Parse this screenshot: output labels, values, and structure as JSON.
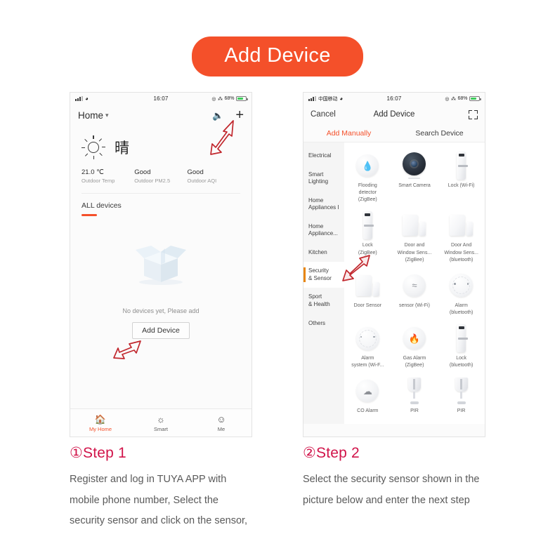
{
  "banner": {
    "title": "Add Device",
    "bg": "#f4502a",
    "fg": "#ffffff"
  },
  "accent": {
    "orange": "#f4502a",
    "crimson": "#d1144a",
    "cat_marker": "#e8860f"
  },
  "left_phone": {
    "status_bar": {
      "carrier": "",
      "time": "16:07",
      "battery_text": "68%",
      "bluetooth_icon": "bluetooth-icon",
      "location_icon": "location-icon",
      "wifi_icon": "wifi-icon",
      "signal_icon": "signal-bars-icon"
    },
    "nav": {
      "home_label": "Home",
      "chevron_icon": "chevron-down-icon",
      "mic_icon": "microphone-icon",
      "add_icon": "plus-icon"
    },
    "weather": {
      "condition_icon": "sun-icon",
      "condition_text": "晴",
      "stats": [
        {
          "value": "21.0 ℃",
          "label": "Outdoor Temp"
        },
        {
          "value": "Good",
          "label": "Outdoor PM2.5"
        },
        {
          "value": "Good",
          "label": "Outdoor AQI"
        }
      ]
    },
    "devices_section": {
      "tab_label": "ALL devices"
    },
    "empty_state": {
      "illustration": "empty-box-icon",
      "message": "No devices yet, Please add",
      "button_label": "Add Device"
    },
    "tabbar": [
      {
        "label": "My Home",
        "icon": "home-icon",
        "active": true
      },
      {
        "label": "Smart",
        "icon": "sun-automation-icon",
        "active": false
      },
      {
        "label": "Me",
        "icon": "user-circle-icon",
        "active": false
      }
    ]
  },
  "right_phone": {
    "status_bar": {
      "carrier": "中国移动",
      "time": "16:07",
      "battery_text": "68%"
    },
    "nav": {
      "cancel_label": "Cancel",
      "title": "Add Device",
      "scan_icon": "scan-qr-icon"
    },
    "tabs": [
      {
        "label": "Add Manually",
        "selected": true
      },
      {
        "label": "Search Device",
        "selected": false
      }
    ],
    "categories": [
      {
        "label": "Electrical",
        "active": false
      },
      {
        "label": "Smart\nLighting",
        "active": false
      },
      {
        "label": "Home\nAppliances I",
        "active": false
      },
      {
        "label": "Home\nAppliance...",
        "active": false
      },
      {
        "label": "Kitchen",
        "active": false
      },
      {
        "label": "Security\n& Sensor",
        "active": true
      },
      {
        "label": "Sport\n& Health",
        "active": false
      },
      {
        "label": "Others",
        "active": false
      }
    ],
    "device_grid": [
      [
        {
          "label": "Flooding\ndetector\n(ZigBee)",
          "icon": "water-drop-sensor-icon"
        },
        {
          "label": "Smart Camera",
          "icon": "camera-icon"
        },
        {
          "label": "Lock (Wi-Fi)",
          "icon": "door-lock-icon"
        }
      ],
      [
        {
          "label": "Lock\n(ZigBee)",
          "icon": "door-lock-icon"
        },
        {
          "label": "Door and\nWindow Sens...\n(ZigBee)",
          "icon": "door-window-sensor-icon"
        },
        {
          "label": "Door And\nWindow Sens...\n(bluetooth)",
          "icon": "door-window-sensor-icon"
        }
      ],
      [
        {
          "label": "Door Sensor",
          "icon": "door-window-sensor-icon"
        },
        {
          "label": "sensor (Wi-Fi)",
          "icon": "motion-waves-sensor-icon"
        },
        {
          "label": "Alarm\n(bluetooth)",
          "icon": "alarm-siren-icon"
        }
      ],
      [
        {
          "label": "Alarm\nsystem (Wi-F...",
          "icon": "alarm-siren-icon"
        },
        {
          "label": "Gas Alarm\n(ZigBee)",
          "icon": "flame-sensor-icon"
        },
        {
          "label": "Lock\n(bluetooth)",
          "icon": "door-lock-icon"
        }
      ],
      [
        {
          "label": "CO Alarm",
          "icon": "co-alarm-icon"
        },
        {
          "label": "PIR",
          "icon": "pir-motion-sensor-icon"
        },
        {
          "label": "PIR",
          "icon": "pir-motion-sensor-icon"
        }
      ]
    ]
  },
  "steps": [
    {
      "heading": "①Step 1",
      "body": "Register and log in TUYA APP with mobile phone number, Select the security sensor and click on the sensor,"
    },
    {
      "heading": "②Step 2",
      "body": "Select the security sensor shown in the picture below and enter the next step"
    }
  ]
}
